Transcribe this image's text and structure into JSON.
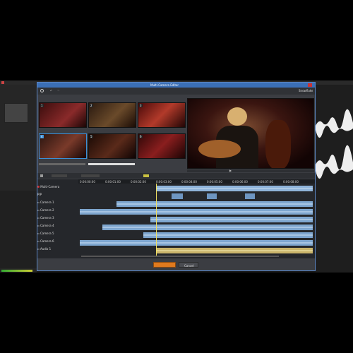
{
  "dialog": {
    "title": "Multi-Camera Editor",
    "ok_label": "",
    "cancel_label": "Cancel",
    "workspace_label": "Snowflake"
  },
  "cameras": [
    {
      "num": "1"
    },
    {
      "num": "2"
    },
    {
      "num": "3"
    },
    {
      "num": "4"
    },
    {
      "num": "5"
    },
    {
      "num": "6"
    }
  ],
  "timeline": {
    "timecodes": [
      "0:00:00:00",
      "0:00:01:00",
      "0:00:02:00",
      "0:00:03:00",
      "0:00:04:00",
      "0:00:05:00",
      "0:00:06:00",
      "0:00:07:00",
      "0:00:08:00"
    ],
    "tracks": [
      "Multi-Camera",
      "PIP",
      "Camera 1",
      "Camera 2",
      "Camera 3",
      "Camera 4",
      "Camera 5",
      "Camera 6",
      "Audio 1"
    ]
  },
  "colors": {
    "accent": "#3b6fb6",
    "clip": "#7ea6cf",
    "audio": "#c9b46a",
    "ok": "#e07a1e"
  }
}
